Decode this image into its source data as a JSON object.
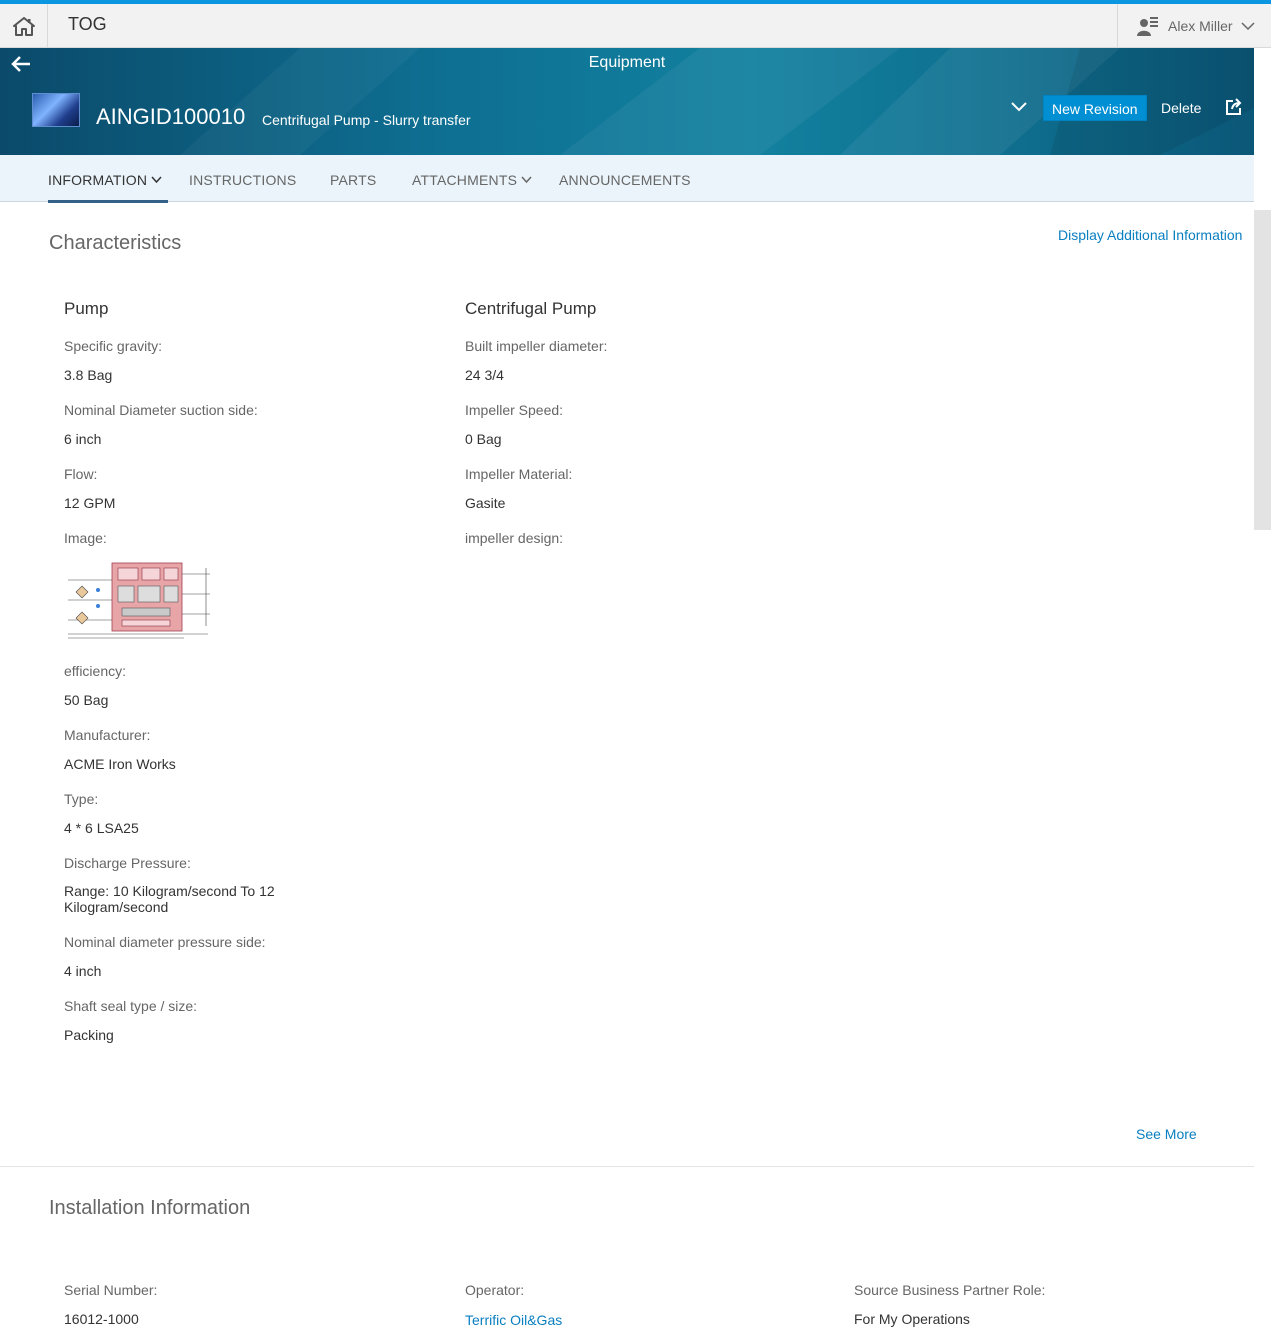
{
  "shell": {
    "title": "TOG",
    "user_name": "Alex Miller"
  },
  "header": {
    "page_title": "Equipment",
    "object_id": "AINGID100010",
    "object_subtitle": "Centrifugal Pump - Slurry transfer",
    "new_revision_label": "New Revision",
    "delete_label": "Delete"
  },
  "tabs": [
    {
      "label": "INFORMATION",
      "has_dropdown": true,
      "active": true
    },
    {
      "label": "INSTRUCTIONS",
      "has_dropdown": false,
      "active": false
    },
    {
      "label": "PARTS",
      "has_dropdown": false,
      "active": false
    },
    {
      "label": "ATTACHMENTS",
      "has_dropdown": true,
      "active": false
    },
    {
      "label": "ANNOUNCEMENTS",
      "has_dropdown": false,
      "active": false
    }
  ],
  "characteristics": {
    "title": "Characteristics",
    "display_additional_label": "Display Additional Information",
    "see_more_label": "See More",
    "pump": {
      "title": "Pump",
      "fields": [
        {
          "label": "Specific gravity:",
          "value": "3.8 Bag"
        },
        {
          "label": "Nominal Diameter suction side:",
          "value": "6 inch"
        },
        {
          "label": "Flow:",
          "value": "12 GPM"
        },
        {
          "label": "Image:",
          "value": ""
        },
        {
          "label": "efficiency:",
          "value": "50 Bag"
        },
        {
          "label": "Manufacturer:",
          "value": "ACME Iron Works"
        },
        {
          "label": "Type:",
          "value": "4 * 6 LSA25"
        },
        {
          "label": "Discharge Pressure:",
          "value": "Range: 10 Kilogram/second To 12",
          "value_line2": "Kilogram/second"
        },
        {
          "label": "Nominal diameter pressure side:",
          "value": "4 inch"
        },
        {
          "label": "Shaft seal type / size:",
          "value": "Packing"
        }
      ]
    },
    "centrifugal": {
      "title": "Centrifugal Pump",
      "fields": [
        {
          "label": "Built impeller diameter:",
          "value": "24 3/4"
        },
        {
          "label": "Impeller Speed:",
          "value": "0 Bag"
        },
        {
          "label": "Impeller Material:",
          "value": "Gasite"
        },
        {
          "label": "impeller design:",
          "value": ""
        }
      ]
    }
  },
  "installation": {
    "title": "Installation Information",
    "fields": [
      {
        "label": "Serial Number:",
        "value": "16012-1000",
        "is_link": false
      },
      {
        "label": "Operator:",
        "value": "Terrific Oil&Gas",
        "is_link": true
      },
      {
        "label": "Source Business Partner Role:",
        "value": "For My Operations",
        "is_link": false
      }
    ]
  },
  "colors": {
    "accent": "#0a96e0",
    "button_blue": "#008fd3",
    "link": "#0a7fc0",
    "header_dark": "#0b4a6a",
    "header_mid": "#12819f",
    "tab_bg": "#eaf4fa"
  },
  "icons": [
    "home-icon",
    "user-icon",
    "chevron-down-icon",
    "back-arrow-icon",
    "share-icon"
  ]
}
